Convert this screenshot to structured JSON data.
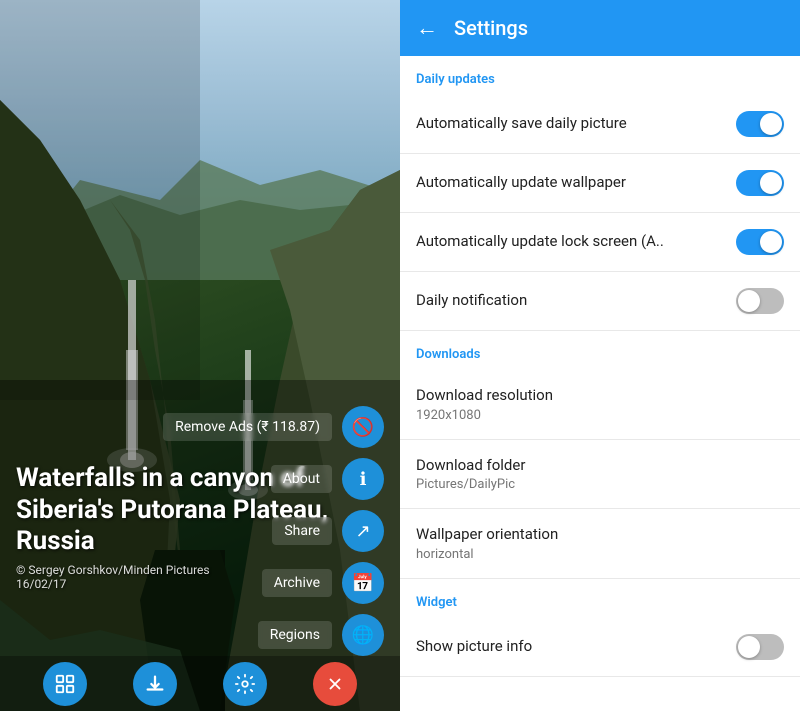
{
  "left": {
    "photo_title": "Waterfalls in a canyon of Siberia's Putorana Plateau, Russia",
    "photo_credit": "© Sergey Gorshkov/Minden Pictures",
    "photo_date": "16/02/17",
    "remove_ads_label": "Remove Ads (₹ 118.87)",
    "about_label": "About",
    "share_label": "Share",
    "archive_label": "Archive",
    "regions_label": "Regions",
    "buttons": {
      "gallery": "🖼",
      "download": "⬇",
      "settings": "⚙",
      "close": "✕"
    }
  },
  "settings": {
    "header_title": "Settings",
    "back_icon": "←",
    "sections": [
      {
        "id": "daily-updates",
        "label": "Daily updates",
        "items": [
          {
            "id": "auto-save",
            "label": "Automatically save daily picture",
            "sub": null,
            "toggle": "on"
          },
          {
            "id": "auto-wallpaper",
            "label": "Automatically update wallpaper",
            "sub": null,
            "toggle": "on"
          },
          {
            "id": "auto-lockscreen",
            "label": "Automatically update lock screen (A..",
            "sub": null,
            "toggle": "on"
          },
          {
            "id": "daily-notification",
            "label": "Daily notification",
            "sub": null,
            "toggle": "off"
          }
        ]
      },
      {
        "id": "downloads",
        "label": "Downloads",
        "items": [
          {
            "id": "download-resolution",
            "label": "Download resolution",
            "sub": "1920x1080",
            "toggle": null
          },
          {
            "id": "download-folder",
            "label": "Download folder",
            "sub": "Pictures/DailyPic",
            "toggle": null
          },
          {
            "id": "wallpaper-orientation",
            "label": "Wallpaper orientation",
            "sub": "horizontal",
            "toggle": null
          }
        ]
      },
      {
        "id": "widget",
        "label": "Widget",
        "items": [
          {
            "id": "show-picture-info",
            "label": "Show picture info",
            "sub": null,
            "toggle": "off"
          }
        ]
      }
    ]
  }
}
